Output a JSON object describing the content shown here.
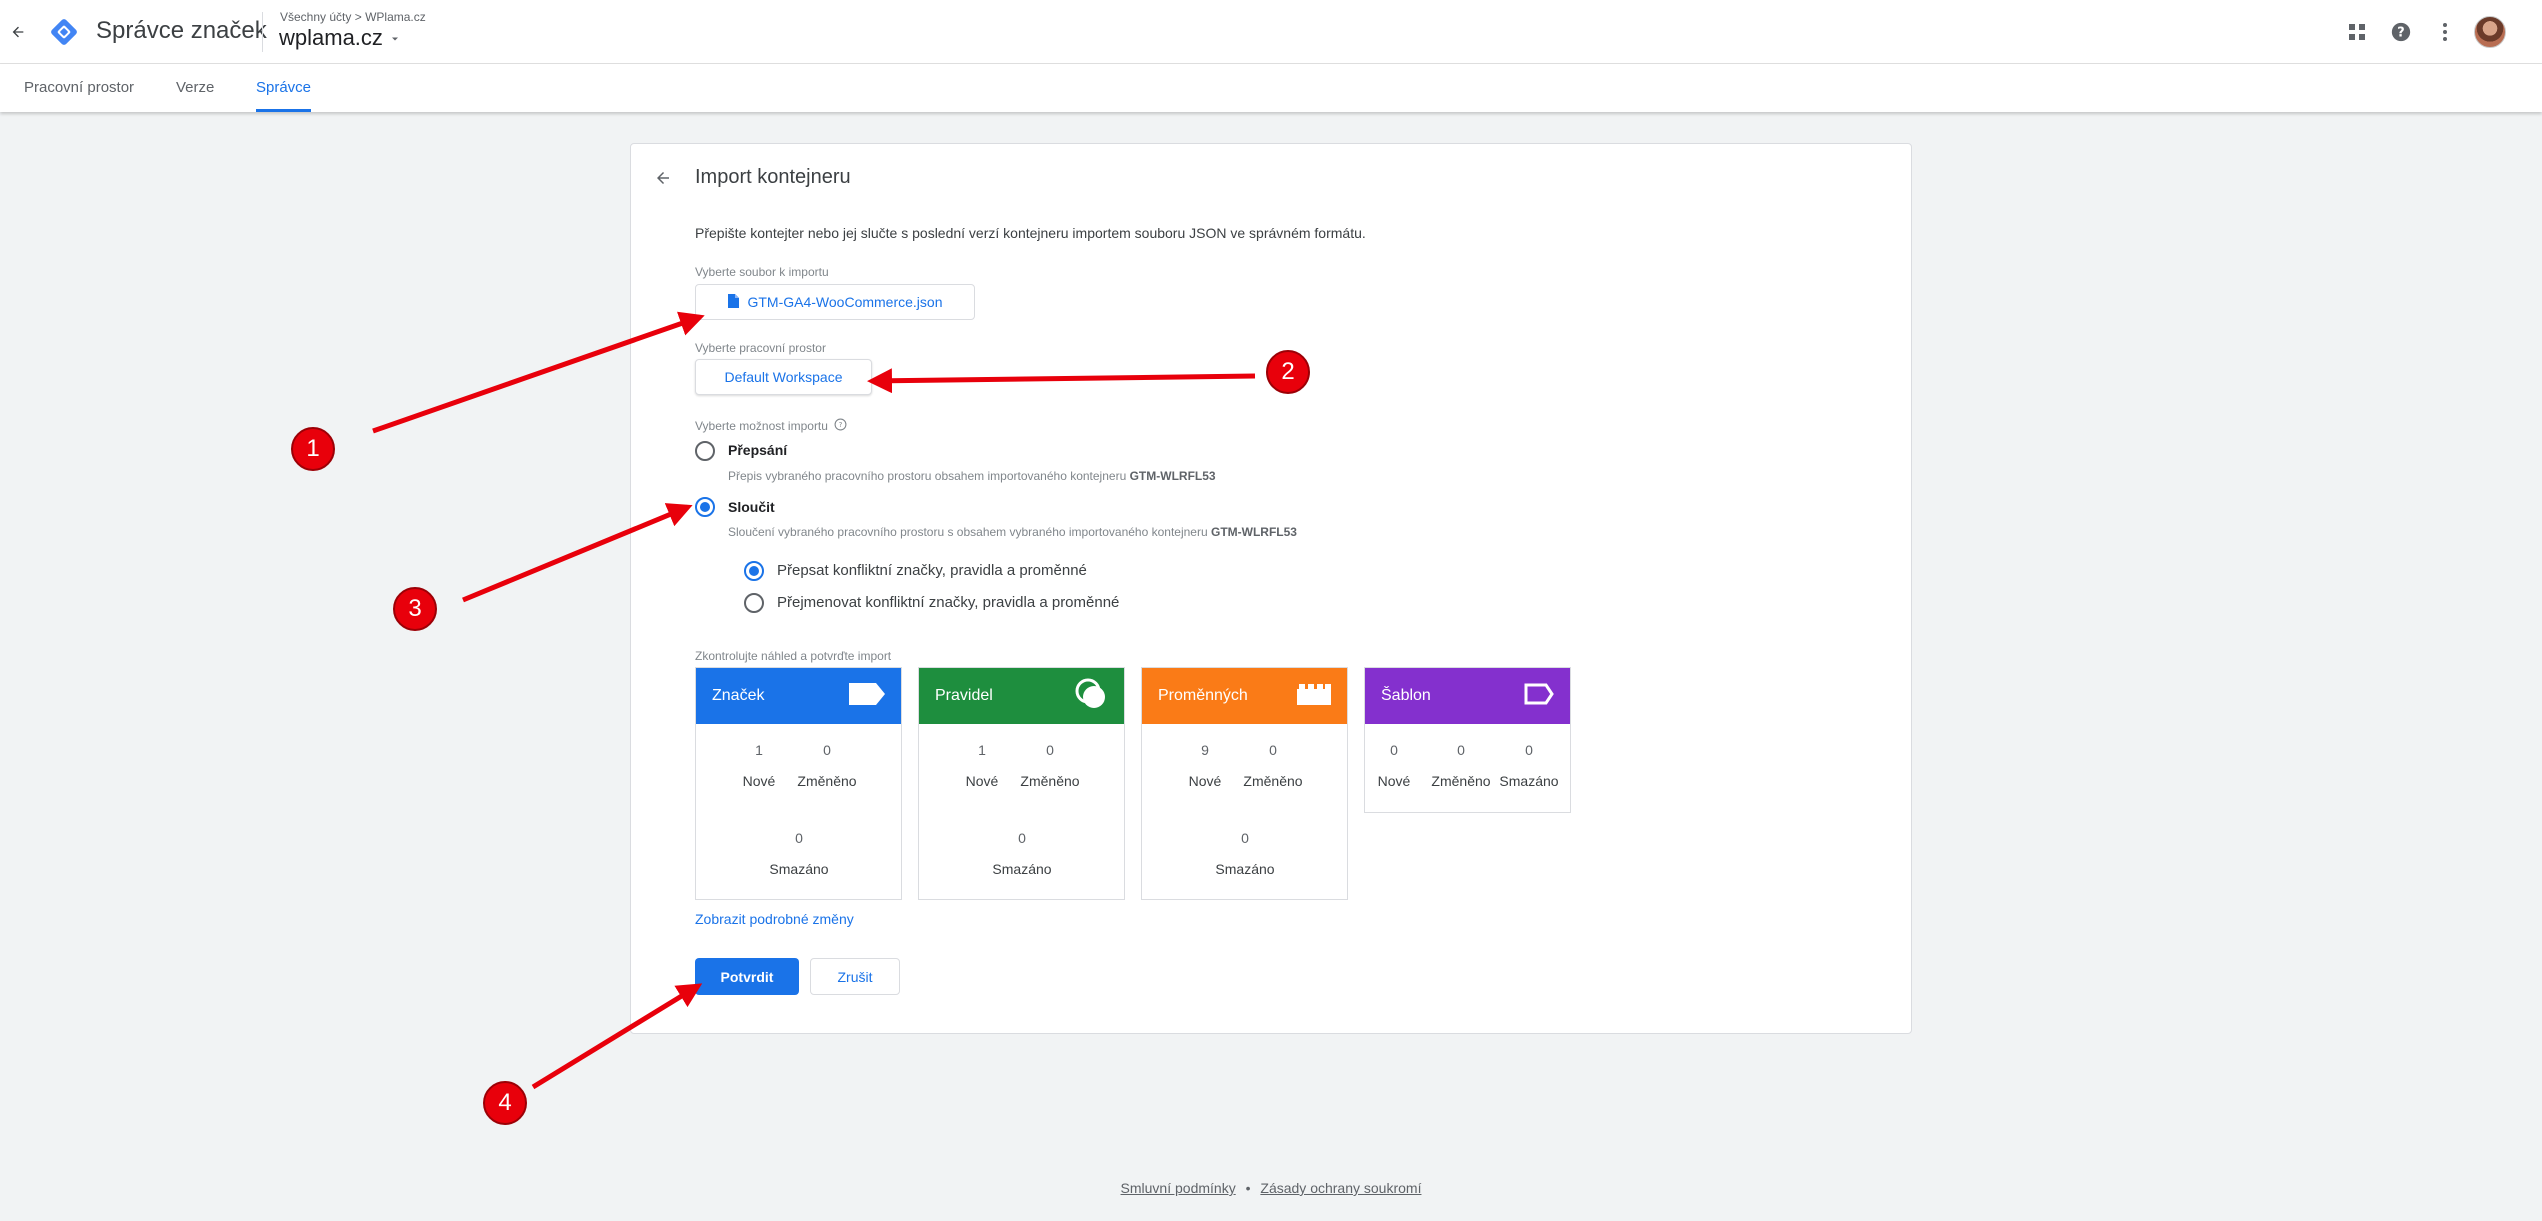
{
  "header": {
    "product_name": "Správce značek",
    "breadcrumb_all": "Všechny účty",
    "breadcrumb_sep": ">",
    "breadcrumb_account": "WPlama.cz",
    "container_name": "wplama.cz",
    "icons": [
      "back-arrow-icon",
      "gtm-logo-icon",
      "apps-grid-icon",
      "help-icon",
      "more-vert-icon",
      "avatar"
    ]
  },
  "tabs": [
    {
      "label": "Pracovní prostor",
      "active": false
    },
    {
      "label": "Verze",
      "active": false
    },
    {
      "label": "Správce",
      "active": true
    }
  ],
  "import": {
    "title": "Import kontejneru",
    "description": "Přepište kontejter nebo jej slučte s poslední verzí kontejneru importem souboru JSON ve správném formátu.",
    "file_label": "Vyberte soubor k importu",
    "file_name": "GTM-GA4-WooCommerce.json",
    "workspace_label": "Vyberte pracovní prostor",
    "workspace_value": "Default Workspace",
    "option_label": "Vyberte možnost importu",
    "options": [
      {
        "title": "Přepsání",
        "desc_prefix": "Přepis vybraného pracovního prostoru obsahem importovaného kontejneru",
        "desc_id": "GTM-WLRFL53",
        "checked": false
      },
      {
        "title": "Sloučit",
        "desc_prefix": "Sloučení vybraného pracovního prostoru s obsahem vybraného importovaného kontejneru",
        "desc_id": "GTM-WLRFL53",
        "checked": true
      }
    ],
    "merge_options": [
      {
        "label": "Přepsat konfliktní značky, pravidla a proměnné",
        "checked": true
      },
      {
        "label": "Přejmenovat konfliktní značky, pravidla a proměnné",
        "checked": false
      }
    ],
    "preview_label": "Zkontrolujte náhled a potvrďte import",
    "summary": [
      {
        "title": "Značek",
        "color": "#1a73e8",
        "icon": "tag-icon",
        "new": "1",
        "changed": "0",
        "deleted": "0"
      },
      {
        "title": "Pravidel",
        "color": "#1e8e3e",
        "icon": "trigger-icon",
        "new": "1",
        "changed": "0",
        "deleted": "0"
      },
      {
        "title": "Proměnných",
        "color": "#fa7b17",
        "icon": "variable-icon",
        "new": "9",
        "changed": "0",
        "deleted": "0"
      },
      {
        "title": "Šablon",
        "color": "#8430ce",
        "icon": "template-icon",
        "new": "0",
        "changed": "0",
        "deleted": "0"
      }
    ],
    "captions": {
      "new": "Nové",
      "changed": "Změněno",
      "deleted": "Smazáno"
    },
    "details_link": "Zobrazit podrobné změny",
    "confirm": "Potvrdit",
    "cancel": "Zrušit"
  },
  "annotations": [
    "1",
    "2",
    "3",
    "4"
  ],
  "footer": {
    "terms": "Smluvní podmínky",
    "separator": "•",
    "privacy": "Zásady ochrany soukromí"
  },
  "colors": {
    "accent": "#1a73e8",
    "annotation": "#e8000b"
  }
}
